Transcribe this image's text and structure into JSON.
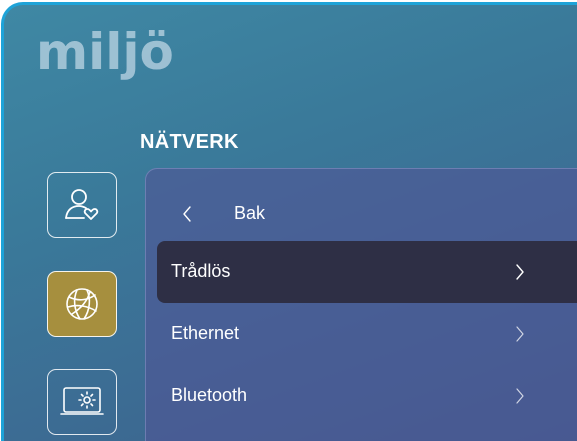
{
  "app": {
    "title": "miljö"
  },
  "section": {
    "heading": "NÄTVERK"
  },
  "sidebar": {
    "items": [
      {
        "icon": "user-heart-icon",
        "selected": false
      },
      {
        "icon": "globe-icon",
        "selected": true,
        "accent": "#a68f3e"
      },
      {
        "icon": "display-settings-icon",
        "selected": false
      }
    ]
  },
  "panel": {
    "back_label": "Bak",
    "items": [
      {
        "label": "Trådlös",
        "selected": true
      },
      {
        "label": "Ethernet",
        "selected": false
      },
      {
        "label": "Bluetooth",
        "selected": false
      }
    ]
  },
  "colors": {
    "frame_border": "#1ea3d8",
    "selected_row": "#2e2f45",
    "accent": "#a68f3e"
  }
}
